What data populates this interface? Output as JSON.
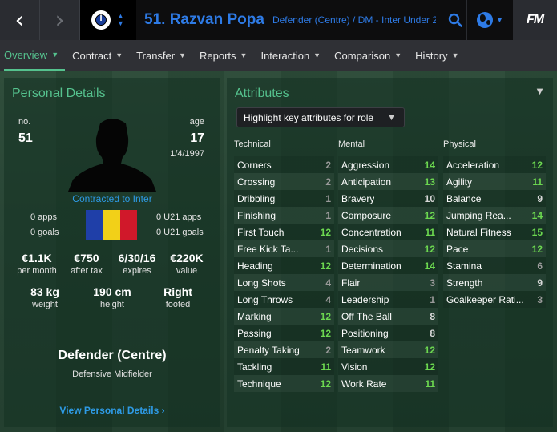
{
  "header": {
    "back_glyph": "‹",
    "forward_glyph": "›",
    "player_name": "51. Razvan Popa",
    "player_sub": "Defender (Centre) / DM - Inter Under 2...",
    "fm_logo": "FM"
  },
  "tabs": [
    {
      "label": "Overview",
      "active": true
    },
    {
      "label": "Contract"
    },
    {
      "label": "Transfer"
    },
    {
      "label": "Reports"
    },
    {
      "label": "Interaction"
    },
    {
      "label": "Comparison"
    },
    {
      "label": "History"
    }
  ],
  "personal": {
    "title": "Personal Details",
    "no_label": "no.",
    "no_value": "51",
    "age_label": "age",
    "age_value": "17",
    "dob": "1/4/1997",
    "contracted": "Contracted to Inter",
    "apps": "0 apps",
    "goals": "0 goals",
    "u21_apps": "0 U21 apps",
    "u21_goals": "0 U21 goals",
    "flag_colors": [
      "#1f3fa8",
      "#f2d018",
      "#d0182a"
    ],
    "stats": [
      {
        "value": "€1.1K",
        "label": "per month"
      },
      {
        "value": "€750",
        "label": "after tax"
      },
      {
        "value": "6/30/16",
        "label": "expires"
      },
      {
        "value": "€220K",
        "label": "value"
      }
    ],
    "physical": [
      {
        "value": "83 kg",
        "label": "weight"
      },
      {
        "value": "190 cm",
        "label": "height"
      },
      {
        "value": "Right",
        "label": "footed"
      }
    ],
    "position_main": "Defender (Centre)",
    "position_sub": "Defensive Midfielder",
    "view_link": "View Personal Details ›"
  },
  "attributes": {
    "title": "Attributes",
    "dropdown_label": "Highlight key attributes for role",
    "columns": [
      {
        "header": "Technical",
        "items": [
          {
            "name": "Corners",
            "value": "2"
          },
          {
            "name": "Crossing",
            "value": "2"
          },
          {
            "name": "Dribbling",
            "value": "1"
          },
          {
            "name": "Finishing",
            "value": "1"
          },
          {
            "name": "First Touch",
            "value": "12"
          },
          {
            "name": "Free Kick Ta...",
            "value": "1"
          },
          {
            "name": "Heading",
            "value": "12"
          },
          {
            "name": "Long Shots",
            "value": "4"
          },
          {
            "name": "Long Throws",
            "value": "4"
          },
          {
            "name": "Marking",
            "value": "12"
          },
          {
            "name": "Passing",
            "value": "12"
          },
          {
            "name": "Penalty Taking",
            "value": "2"
          },
          {
            "name": "Tackling",
            "value": "11"
          },
          {
            "name": "Technique",
            "value": "12"
          }
        ]
      },
      {
        "header": "Mental",
        "items": [
          {
            "name": "Aggression",
            "value": "14"
          },
          {
            "name": "Anticipation",
            "value": "13"
          },
          {
            "name": "Bravery",
            "value": "10"
          },
          {
            "name": "Composure",
            "value": "12"
          },
          {
            "name": "Concentration",
            "value": "11"
          },
          {
            "name": "Decisions",
            "value": "12"
          },
          {
            "name": "Determination",
            "value": "14"
          },
          {
            "name": "Flair",
            "value": "3"
          },
          {
            "name": "Leadership",
            "value": "1"
          },
          {
            "name": "Off The Ball",
            "value": "8"
          },
          {
            "name": "Positioning",
            "value": "8"
          },
          {
            "name": "Teamwork",
            "value": "12"
          },
          {
            "name": "Vision",
            "value": "12"
          },
          {
            "name": "Work Rate",
            "value": "11"
          }
        ]
      },
      {
        "header": "Physical",
        "items": [
          {
            "name": "Acceleration",
            "value": "12"
          },
          {
            "name": "Agility",
            "value": "11"
          },
          {
            "name": "Balance",
            "value": "9"
          },
          {
            "name": "Jumping Rea...",
            "value": "14"
          },
          {
            "name": "Natural Fitness",
            "value": "15"
          },
          {
            "name": "Pace",
            "value": "12"
          },
          {
            "name": "Stamina",
            "value": "6"
          },
          {
            "name": "Strength",
            "value": "9"
          },
          {
            "name": "Goalkeeper Rati...",
            "value": "3"
          }
        ]
      }
    ]
  }
}
